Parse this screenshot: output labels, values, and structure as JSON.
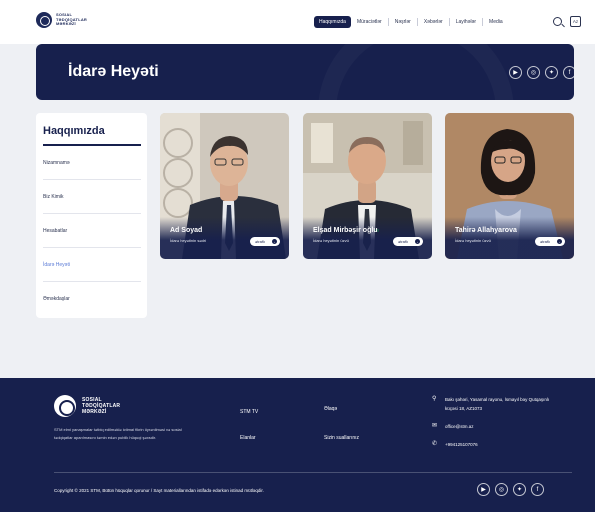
{
  "header": {
    "logo_text": [
      "SOSIAL",
      "TƏDQİQATLAR",
      "MƏRKƏZİ"
    ],
    "nav": [
      "Haqqımızda",
      "Müraciətlər",
      "Nəşrlər",
      "Xəbərlər",
      "Layihələr",
      "Media"
    ],
    "nav_active_index": 0,
    "lang_label": "Az"
  },
  "banner": {
    "title": "İdarə Heyəti"
  },
  "social_icons": [
    "youtube-icon",
    "instagram-icon",
    "twitter-icon",
    "facebook-icon"
  ],
  "sidebar": {
    "title": "Haqqımızda",
    "items": [
      "Nizamnamə",
      "Biz Kimik",
      "Hesabatlar",
      "İdarə Heyəti",
      "Əməkdaşlar"
    ],
    "active_index": 3
  },
  "members": [
    {
      "name": "Ad Soyad",
      "role": "İdarə heyətinin sədri",
      "button": "ətraflı"
    },
    {
      "name": "Elşad Mirbəşir oğlu",
      "role": "İdarə heyətinin üzvü",
      "button": "ətraflı"
    },
    {
      "name": "Tahirə Allahyarova",
      "role": "İdarə heyətinin üzvü",
      "button": "ətraflı"
    }
  ],
  "footer": {
    "logo_text": [
      "SOSIAL",
      "TƏDQİQATLAR",
      "MƏRKƏZİ"
    ],
    "description": "STM elmi yanaşmalar tətbiq edilməklə ictimai fikrin öyrənilməsi və sosial tədqiqatlar aparılmasını təmin edən publik hüquqi şəxsdir.",
    "links": [
      "STM TV",
      "Əlaqə",
      "Elanlar",
      "Sizin suallarınız"
    ],
    "contact": {
      "address": "Bakı şəhəri, Yasamal rayonu, İsmayıl bəy Qutqaşınlı küçəsi 18, AZ1073",
      "email": "office@stm.az",
      "phone": "+994125107076"
    },
    "copyright": "Copyright © 2021 STM, Bütün hüquqlar qorunur / Sayt materiallarından istifadə edərkən istinad mütləqdir."
  },
  "colors": {
    "navy": "#17204d",
    "accent": "#5b7bd6",
    "page_bg": "#eef0f4"
  }
}
